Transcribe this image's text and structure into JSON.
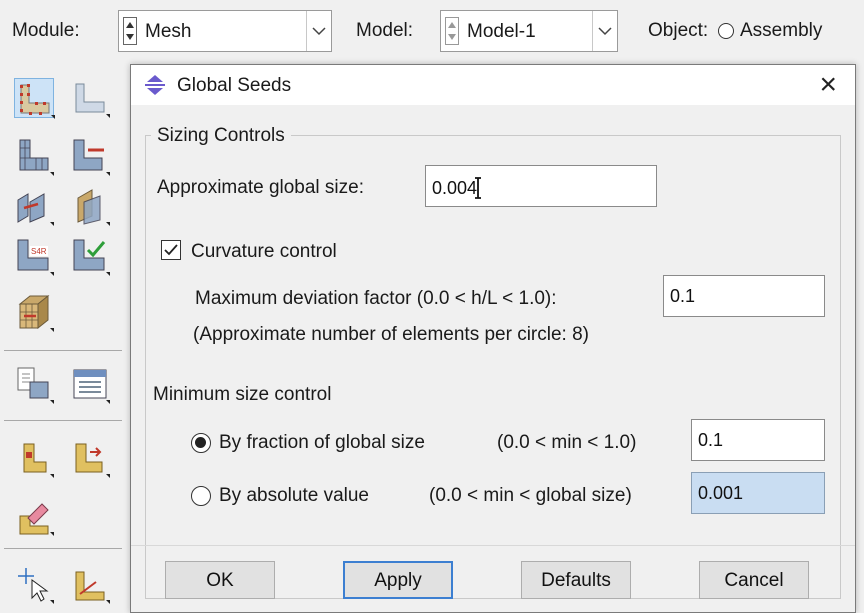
{
  "toolbar": {
    "module_label": "Module:",
    "module_value": "Mesh",
    "model_label": "Model:",
    "model_value": "Model-1",
    "object_label": "Object:",
    "object_option": "Assembly"
  },
  "dialog": {
    "title": "Global Seeds",
    "sizing_controls": {
      "title": "Sizing Controls",
      "approx_size_label": "Approximate global size:",
      "approx_size_value": "0.004",
      "curvature_label": "Curvature control",
      "curvature_checked": true,
      "max_dev_label": "Maximum deviation factor (0.0 < h/L < 1.0):",
      "max_dev_value": "0.1",
      "approx_elements_note": "(Approximate number of elements per circle: 8)"
    },
    "min_size": {
      "title": "Minimum size control",
      "fraction_label": "By fraction of global size",
      "fraction_range": "(0.0 < min < 1.0)",
      "fraction_value": "0.1",
      "fraction_selected": true,
      "absolute_label": "By absolute value",
      "absolute_range": "(0.0 < min < global size)",
      "absolute_value": "0.001",
      "absolute_selected": false
    },
    "buttons": {
      "ok": "OK",
      "apply": "Apply",
      "defaults": "Defaults",
      "cancel": "Cancel"
    }
  },
  "colors": {
    "accent_blue": "#3c7fd1",
    "selected_field": "#c9ddf2",
    "icon_red": "#c0392b",
    "icon_tan": "#c9a86a"
  }
}
